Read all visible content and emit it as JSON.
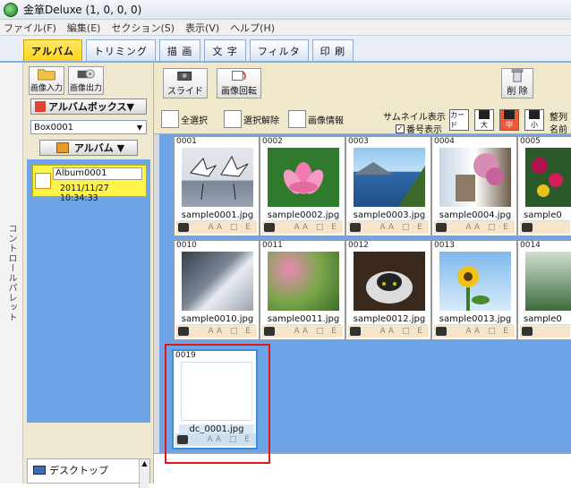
{
  "window": {
    "title": "金箪Deluxe (1, 0, 0, 0)"
  },
  "menu": [
    "ファイル(F)",
    "編集(E)",
    "セクション(S)",
    "表示(V)",
    "ヘルプ(H)"
  ],
  "tabs": [
    "アルバム",
    "トリミング",
    "描 画",
    "文 字",
    "フィルタ",
    "印 刷"
  ],
  "control_palette": "コントロールパレット",
  "left_panel": {
    "import_label": "画像入力",
    "export_label": "画像出力",
    "album_box_label": "アルバムボックス▼",
    "box_select": "Box0001",
    "album_dropdown": "アルバム ▼",
    "album": {
      "name": "Album0001",
      "date": "2011/11/27 10:34:33"
    },
    "tree_item": "デスクトップ"
  },
  "toolbar": {
    "slide_label": "スライド",
    "rotate_label": "画像回転",
    "delete_label": "削 除",
    "select_all": "全選択",
    "deselect": "選択解除",
    "image_info": "画像情報",
    "thumb_display": "サムネイル表示",
    "number_display": "番号表示",
    "size_card": "カード",
    "size_large": "大",
    "size_medium": "中",
    "size_small": "小",
    "sort_label": "整列",
    "name_label": "名前"
  },
  "thumbnails": [
    {
      "num": "0001",
      "file": "sample0001.jpg"
    },
    {
      "num": "0002",
      "file": "sample0002.jpg"
    },
    {
      "num": "0003",
      "file": "sample0003.jpg"
    },
    {
      "num": "0004",
      "file": "sample0004.jpg"
    },
    {
      "num": "0005",
      "file": "sample0"
    },
    {
      "num": "0010",
      "file": "sample0010.jpg"
    },
    {
      "num": "0011",
      "file": "sample0011.jpg"
    },
    {
      "num": "0012",
      "file": "sample0012.jpg"
    },
    {
      "num": "0013",
      "file": "sample0013.jpg"
    },
    {
      "num": "0014",
      "file": "sample0"
    },
    {
      "num": "0019",
      "file": "dc_0001.jpg"
    }
  ],
  "card_flags": "AA □ E",
  "colors": {
    "active_tab": "#ffd21a",
    "grid_bg": "#6fa5e6",
    "highlight": "#e01818"
  }
}
